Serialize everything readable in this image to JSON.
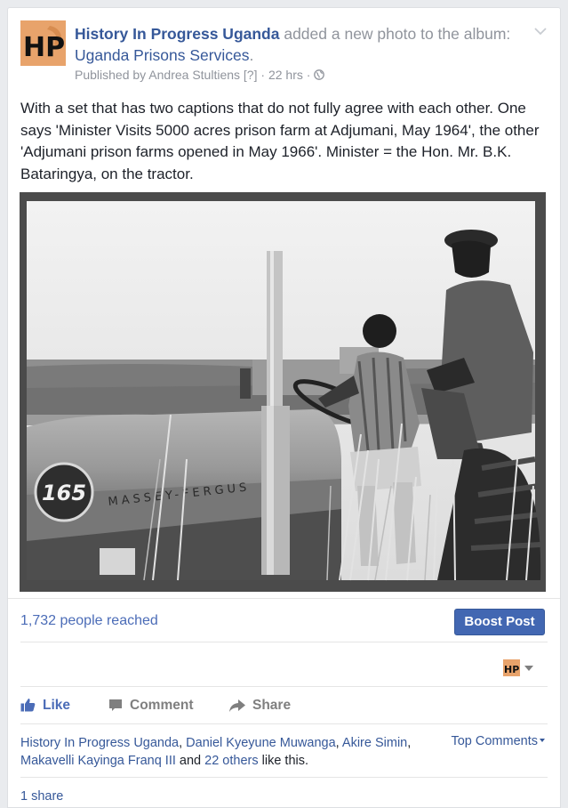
{
  "header": {
    "page_name": "History In Progress Uganda",
    "action_text": " added a new photo to the album: ",
    "album_name": "Uganda Prisons Services",
    "album_suffix": ".",
    "published_prefix": "Published by ",
    "publisher": "Andrea Stultiens",
    "help_marker": "[?]",
    "time": "22 hrs",
    "separator": "·"
  },
  "logo_text": "HP",
  "post_text": "With a set that has two captions that do not fully agree with each other. One says 'Minister Visits 5000 acres prison farm at Adjumani, May 1964', the other 'Adjumani prison farms opened in May 1966'. Minister = the Hon. Mr. B.K. Bataringya, on the tractor.",
  "photo": {
    "badge_number": "165",
    "tractor_brand": "MASSEY-FERGUS"
  },
  "stats": {
    "reached": "1,732 people reached",
    "boost_label": "Boost Post"
  },
  "actions": {
    "like": "Like",
    "comment": "Comment",
    "share": "Share"
  },
  "likes": {
    "names": [
      "History In Progress Uganda",
      "Daniel Kyeyune Muwanga",
      "Akire Simin",
      "Makavelli Kayinga Franq III"
    ],
    "comma": ", ",
    "and": " and ",
    "others": "22 others",
    "suffix": " like this."
  },
  "top_comments": "Top Comments",
  "shares": "1 share",
  "icons": {
    "globe": "globe-icon",
    "chevron": "chevron-down-icon",
    "like": "thumbs-up-icon",
    "comment": "comment-bubble-icon",
    "share": "share-arrow-icon"
  },
  "colors": {
    "link": "#365899",
    "boost_bg": "#4267b2",
    "meta_gray": "#90949c",
    "logo_bg": "#e8a36b"
  }
}
